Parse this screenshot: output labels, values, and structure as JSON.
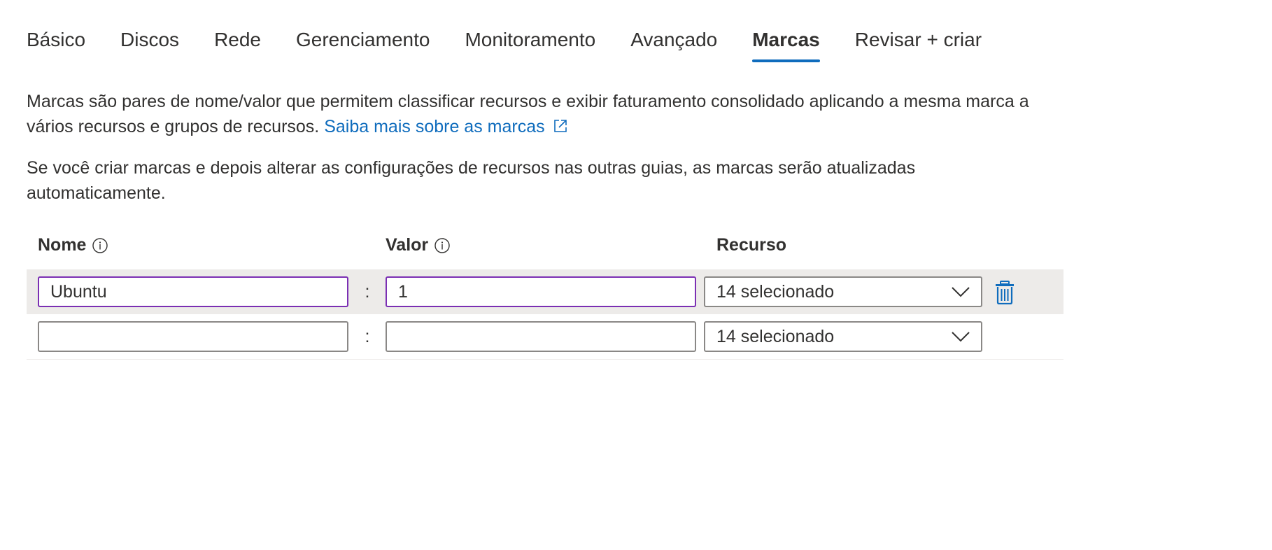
{
  "tabs": [
    {
      "label": "Básico"
    },
    {
      "label": "Discos"
    },
    {
      "label": "Rede"
    },
    {
      "label": "Gerenciamento"
    },
    {
      "label": "Monitoramento"
    },
    {
      "label": "Avançado"
    },
    {
      "label": "Marcas",
      "active": true
    },
    {
      "label": "Revisar + criar"
    }
  ],
  "intro": {
    "text": "Marcas são pares de nome/valor que permitem classificar recursos e exibir faturamento consolidado aplicando a mesma marca a vários recursos e grupos de recursos.",
    "link_label": "Saiba mais sobre as marcas",
    "link_icon": "external-link-icon"
  },
  "note": "Se você criar marcas e depois alterar as configurações de recursos nas outras guias, as marcas serão atualizadas automaticamente.",
  "table": {
    "headers": {
      "name": "Nome",
      "value": "Valor",
      "resource": "Recurso"
    },
    "separator": ":",
    "rows": [
      {
        "name": "Ubuntu",
        "value": "1",
        "resource": "14 selecionado"
      },
      {
        "name": "",
        "value": "",
        "resource": "14 selecionado"
      }
    ]
  },
  "colors": {
    "accent": "#0f6cbd",
    "focus_border": "#7b2fb3",
    "row_highlight": "#edebe9",
    "text": "#323130"
  }
}
